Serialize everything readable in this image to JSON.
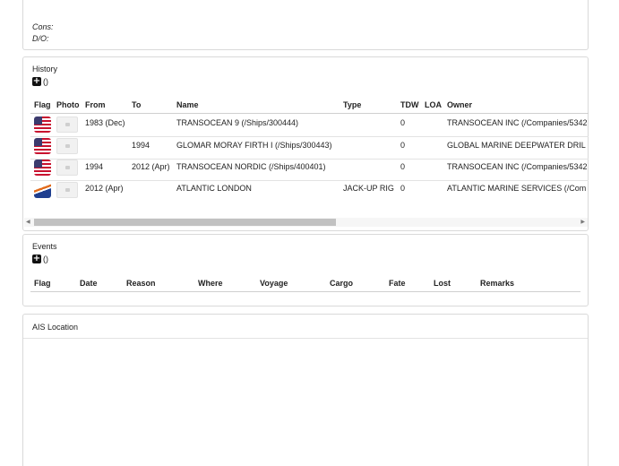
{
  "top": {
    "cons_label": "Cons:",
    "do_label": "D/O:"
  },
  "history": {
    "title": "History",
    "add_count": "()",
    "headers": [
      "Flag",
      "Photo",
      "From",
      "To",
      "Name",
      "Type",
      "TDW",
      "LOA",
      "Owner"
    ],
    "rows": [
      {
        "flag": "us-flag-icon",
        "from": "1983 (Dec)",
        "to": "",
        "name": "TRANSOCEAN 9 (/Ships/300444)",
        "type": "",
        "tdw": "0",
        "loa": "",
        "owner": "TRANSOCEAN INC (/Companies/5342"
      },
      {
        "flag": "us-flag-icon",
        "from": "",
        "to": "1994",
        "name": "GLOMAR MORAY FIRTH I (/Ships/300443)",
        "type": "",
        "tdw": "0",
        "loa": "",
        "owner": "GLOBAL MARINE DEEPWATER DRIL"
      },
      {
        "flag": "us-flag-icon",
        "from": "1994",
        "to": "2012 (Apr)",
        "name": "TRANSOCEAN NORDIC (/Ships/400401)",
        "type": "",
        "tdw": "0",
        "loa": "",
        "owner": "TRANSOCEAN INC (/Companies/5342"
      },
      {
        "flag": "marshall-islands-flag-icon",
        "from": "2012 (Apr)",
        "to": "",
        "name": "ATLANTIC LONDON",
        "type": "JACK-UP RIG",
        "tdw": "0",
        "loa": "",
        "owner": "ATLANTIC MARINE SERVICES (/Com"
      }
    ]
  },
  "events": {
    "title": "Events",
    "add_count": "()",
    "headers": [
      "Flag",
      "Date",
      "Reason",
      "Where",
      "Voyage",
      "Cargo",
      "Fate",
      "Lost",
      "Remarks"
    ]
  },
  "ais": {
    "title": "AIS Location"
  }
}
